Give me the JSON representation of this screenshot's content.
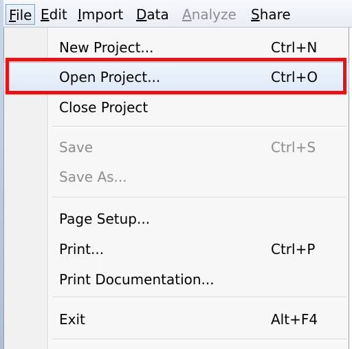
{
  "menubar": {
    "items": [
      {
        "label": "File",
        "mnemonic_index": 0
      },
      {
        "label": "Edit",
        "mnemonic_index": 0
      },
      {
        "label": "Import",
        "mnemonic_index": 0
      },
      {
        "label": "Data",
        "mnemonic_index": 0
      },
      {
        "label": "Analyze",
        "mnemonic_index": 0
      },
      {
        "label": "Share",
        "mnemonic_index": 0
      }
    ]
  },
  "file_menu": {
    "new_project": {
      "label": "New Project...",
      "shortcut": "Ctrl+N"
    },
    "open_project": {
      "label": "Open Project...",
      "shortcut": "Ctrl+O"
    },
    "close_project": {
      "label": "Close Project"
    },
    "save": {
      "label": "Save",
      "shortcut": "Ctrl+S"
    },
    "save_as": {
      "label": "Save As..."
    },
    "page_setup": {
      "label": "Page Setup..."
    },
    "print": {
      "label": "Print...",
      "shortcut": "Ctrl+P"
    },
    "print_documentation": {
      "label": "Print Documentation..."
    },
    "exit": {
      "label": "Exit",
      "shortcut": "Alt+F4"
    }
  },
  "colors": {
    "highlight_box": "#ee1111",
    "disabled_text": "#8d8d8d",
    "hover_background": "#dfeaf8"
  }
}
